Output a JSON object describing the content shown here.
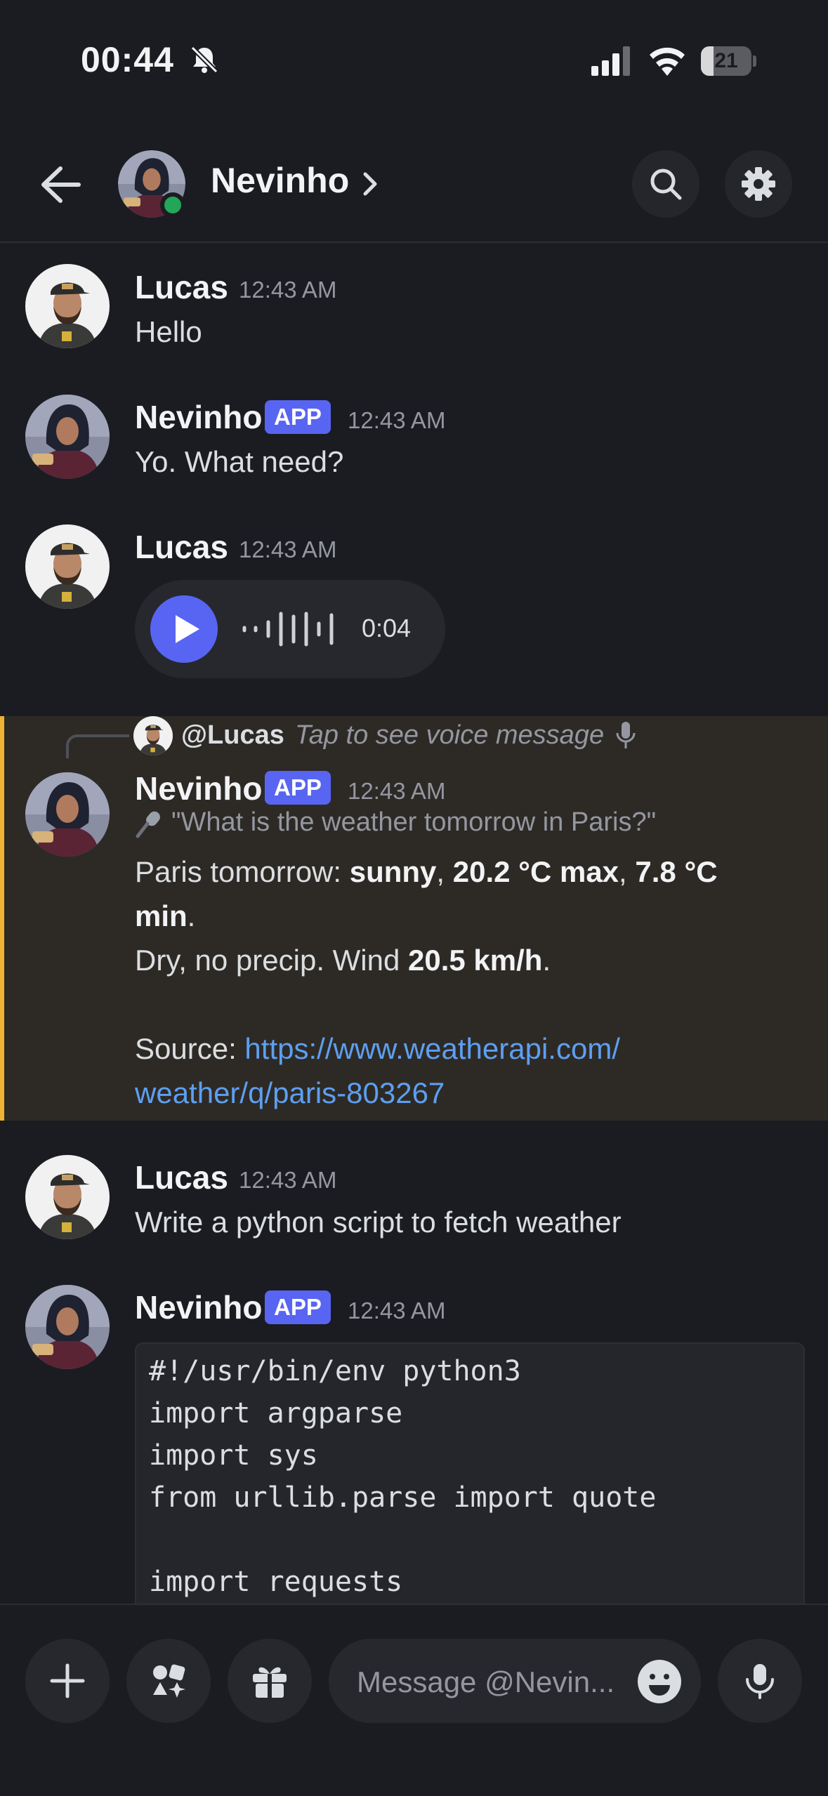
{
  "status_bar": {
    "time": "00:44",
    "battery": "21"
  },
  "header": {
    "title": "Nevinho"
  },
  "messages": [
    {
      "author": "Lucas",
      "time": "12:43 AM",
      "text": "Hello"
    },
    {
      "author": "Nevinho",
      "badge": "APP",
      "time": "12:43 AM",
      "text": "Yo. What need?"
    },
    {
      "author": "Lucas",
      "time": "12:43 AM",
      "voice_duration": "0:04"
    },
    {
      "reply_mention": "@Lucas",
      "reply_preview": "Tap to see voice message",
      "author": "Nevinho",
      "badge": "APP",
      "time": "12:43 AM",
      "transcript": "\"What is the weather tomorrow in Paris?\"",
      "line1_prefix": "Paris tomorrow: ",
      "condition": "sunny",
      "sep1": ", ",
      "max": "20.2 °C max",
      "sep2": ", ",
      "min_part1": "7.8 °C",
      "min_part2": "min",
      "end1": ".",
      "line2_prefix": "Dry, no precip. Wind ",
      "wind": "20.5 km/h",
      "end2": ".",
      "source_label": "Source: ",
      "source_link_part1": "https://www.weatherapi.com/",
      "source_link_part2": "weather/q/paris-803267"
    },
    {
      "author": "Lucas",
      "time": "12:43 AM",
      "text": "Write a python script to fetch weather"
    },
    {
      "author": "Nevinho",
      "badge": "APP",
      "time": "12:43 AM",
      "code": [
        "#!/usr/bin/env python3",
        "import argparse",
        "import sys",
        "from urllib.parse import quote",
        "",
        "import requests"
      ]
    }
  ],
  "composer": {
    "placeholder": "Message @Nevin..."
  },
  "colors": {
    "accent": "#5865f2",
    "online": "#23a55a",
    "highlight_bar": "#f0b232",
    "link": "#5e9ff0"
  }
}
